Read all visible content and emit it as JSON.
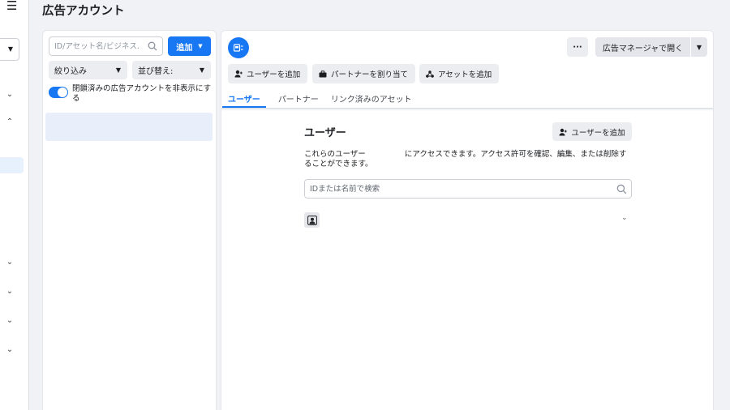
{
  "page": {
    "title": "広告アカウント"
  },
  "rail": {
    "chevrons": [
      "⌄",
      "⌃",
      "⌄",
      "⌄",
      "⌄",
      "⌄"
    ]
  },
  "left_panel": {
    "search_placeholder": "ID/アセット名/ビジネス...",
    "add_button": "追加",
    "filter_label": "絞り込み",
    "sort_label": "並び替え:",
    "toggle_label": "閉鎖済みの広告アカウントを非表示にする",
    "toggle_on": true
  },
  "right_panel": {
    "more_button": "···",
    "open_manager_button": "広告マネージャで開く",
    "actions": {
      "add_user": "ユーザーを追加",
      "assign_partner": "パートナーを割り当て",
      "add_asset": "アセットを追加"
    },
    "tabs": [
      "ユーザー",
      "パートナー",
      "リンク済みのアセット"
    ],
    "active_tab": "ユーザー",
    "section": {
      "title": "ユーザー",
      "add_user_button": "ユーザーを追加",
      "desc_part1": "これらのユーザー",
      "desc_part2": "にアクセスできます。アクセス許可を確認、編集、または削除す",
      "desc_part3": "ることができます。",
      "search_placeholder": "IDまたは名前で検索"
    }
  },
  "colors": {
    "accent": "#1877f2",
    "page_bg": "#f0f2f5",
    "selected_row": "#e8effa"
  },
  "icons": [
    "hamburger-icon",
    "search-icon",
    "account-icon",
    "user-add-icon",
    "briefcase-icon",
    "asset-icon",
    "user-avatar-icon",
    "chevron-down-icon"
  ]
}
